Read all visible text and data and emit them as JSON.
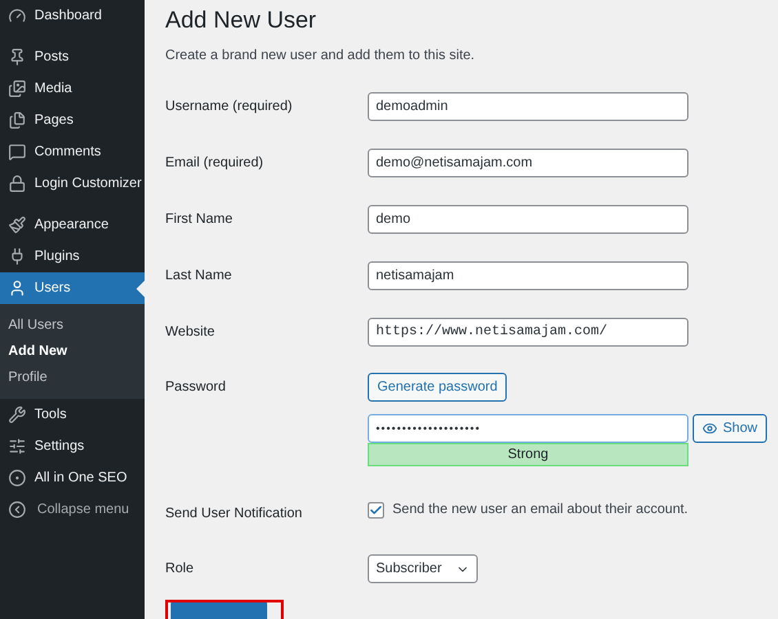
{
  "sidebar": {
    "groups": [
      [
        {
          "label": "Dashboard",
          "selected": false
        }
      ],
      [
        {
          "label": "Posts",
          "selected": false
        },
        {
          "label": "Media",
          "selected": false
        },
        {
          "label": "Pages",
          "selected": false
        },
        {
          "label": "Comments",
          "selected": false
        },
        {
          "label": "Login Customizer",
          "selected": false
        }
      ],
      [
        {
          "label": "Appearance",
          "selected": false
        },
        {
          "label": "Plugins",
          "selected": false
        },
        {
          "label": "Users",
          "selected": true,
          "children": [
            {
              "label": "All Users",
              "selected": false
            },
            {
              "label": "Add New",
              "selected": true
            },
            {
              "label": "Profile",
              "selected": false
            }
          ]
        },
        {
          "label": "Tools",
          "selected": false
        },
        {
          "label": "Settings",
          "selected": false
        },
        {
          "label": "All in One SEO",
          "selected": false
        }
      ]
    ],
    "collapse_menu": "Collapse menu"
  },
  "page": {
    "title": "Add New User",
    "description": "Create a brand new user and add them to this site.",
    "fields": [
      {
        "kind": "text",
        "label": "Username (required)",
        "value": "demoadmin"
      },
      {
        "kind": "text",
        "label": "Email (required)",
        "value": "demo@netisamajam.com"
      },
      {
        "kind": "text",
        "label": "First Name",
        "value": "demo"
      },
      {
        "kind": "text",
        "label": "Last Name",
        "value": "netisamajam"
      },
      {
        "kind": "url",
        "label": "Website",
        "value": "https://www.netisamajam.com/"
      },
      {
        "kind": "password",
        "label": "Password",
        "generate_button": "Generate password",
        "value": "••••••••••••••••••••",
        "show_button": "Show",
        "strength": "Strong"
      },
      {
        "kind": "checkbox",
        "label": "Send User Notification",
        "checked": true,
        "text": "Send the new user an email about their account."
      },
      {
        "kind": "select",
        "label": "Role",
        "value": "Subscriber"
      }
    ],
    "submit_highlighted": true
  }
}
